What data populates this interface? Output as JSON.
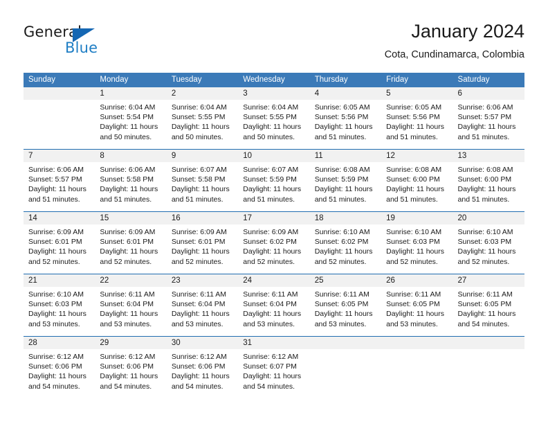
{
  "brand": {
    "name_top": "General",
    "name_bottom": "Blue",
    "triangle_color": "#1567b3",
    "blue_color": "#1f7ec4"
  },
  "header": {
    "title": "January 2024",
    "subtitle": "Cota, Cundinamarca, Colombia"
  },
  "theme": {
    "header_blue": "#3b7ab8",
    "row_rule_blue": "#1f6cb0",
    "daynum_band": "#f1f1f1",
    "text": "#1a1a1a"
  },
  "calendar": {
    "weekday_headers": [
      "Sunday",
      "Monday",
      "Tuesday",
      "Wednesday",
      "Thursday",
      "Friday",
      "Saturday"
    ],
    "weeks": [
      [
        {
          "day": "",
          "sunrise": "",
          "sunset": "",
          "daylight": "",
          "empty": true
        },
        {
          "day": "1",
          "sunrise": "Sunrise: 6:04 AM",
          "sunset": "Sunset: 5:54 PM",
          "daylight": "Daylight: 11 hours and 50 minutes."
        },
        {
          "day": "2",
          "sunrise": "Sunrise: 6:04 AM",
          "sunset": "Sunset: 5:55 PM",
          "daylight": "Daylight: 11 hours and 50 minutes."
        },
        {
          "day": "3",
          "sunrise": "Sunrise: 6:04 AM",
          "sunset": "Sunset: 5:55 PM",
          "daylight": "Daylight: 11 hours and 50 minutes."
        },
        {
          "day": "4",
          "sunrise": "Sunrise: 6:05 AM",
          "sunset": "Sunset: 5:56 PM",
          "daylight": "Daylight: 11 hours and 51 minutes."
        },
        {
          "day": "5",
          "sunrise": "Sunrise: 6:05 AM",
          "sunset": "Sunset: 5:56 PM",
          "daylight": "Daylight: 11 hours and 51 minutes."
        },
        {
          "day": "6",
          "sunrise": "Sunrise: 6:06 AM",
          "sunset": "Sunset: 5:57 PM",
          "daylight": "Daylight: 11 hours and 51 minutes."
        }
      ],
      [
        {
          "day": "7",
          "sunrise": "Sunrise: 6:06 AM",
          "sunset": "Sunset: 5:57 PM",
          "daylight": "Daylight: 11 hours and 51 minutes."
        },
        {
          "day": "8",
          "sunrise": "Sunrise: 6:06 AM",
          "sunset": "Sunset: 5:58 PM",
          "daylight": "Daylight: 11 hours and 51 minutes."
        },
        {
          "day": "9",
          "sunrise": "Sunrise: 6:07 AM",
          "sunset": "Sunset: 5:58 PM",
          "daylight": "Daylight: 11 hours and 51 minutes."
        },
        {
          "day": "10",
          "sunrise": "Sunrise: 6:07 AM",
          "sunset": "Sunset: 5:59 PM",
          "daylight": "Daylight: 11 hours and 51 minutes."
        },
        {
          "day": "11",
          "sunrise": "Sunrise: 6:08 AM",
          "sunset": "Sunset: 5:59 PM",
          "daylight": "Daylight: 11 hours and 51 minutes."
        },
        {
          "day": "12",
          "sunrise": "Sunrise: 6:08 AM",
          "sunset": "Sunset: 6:00 PM",
          "daylight": "Daylight: 11 hours and 51 minutes."
        },
        {
          "day": "13",
          "sunrise": "Sunrise: 6:08 AM",
          "sunset": "Sunset: 6:00 PM",
          "daylight": "Daylight: 11 hours and 51 minutes."
        }
      ],
      [
        {
          "day": "14",
          "sunrise": "Sunrise: 6:09 AM",
          "sunset": "Sunset: 6:01 PM",
          "daylight": "Daylight: 11 hours and 52 minutes."
        },
        {
          "day": "15",
          "sunrise": "Sunrise: 6:09 AM",
          "sunset": "Sunset: 6:01 PM",
          "daylight": "Daylight: 11 hours and 52 minutes."
        },
        {
          "day": "16",
          "sunrise": "Sunrise: 6:09 AM",
          "sunset": "Sunset: 6:01 PM",
          "daylight": "Daylight: 11 hours and 52 minutes."
        },
        {
          "day": "17",
          "sunrise": "Sunrise: 6:09 AM",
          "sunset": "Sunset: 6:02 PM",
          "daylight": "Daylight: 11 hours and 52 minutes."
        },
        {
          "day": "18",
          "sunrise": "Sunrise: 6:10 AM",
          "sunset": "Sunset: 6:02 PM",
          "daylight": "Daylight: 11 hours and 52 minutes."
        },
        {
          "day": "19",
          "sunrise": "Sunrise: 6:10 AM",
          "sunset": "Sunset: 6:03 PM",
          "daylight": "Daylight: 11 hours and 52 minutes."
        },
        {
          "day": "20",
          "sunrise": "Sunrise: 6:10 AM",
          "sunset": "Sunset: 6:03 PM",
          "daylight": "Daylight: 11 hours and 52 minutes."
        }
      ],
      [
        {
          "day": "21",
          "sunrise": "Sunrise: 6:10 AM",
          "sunset": "Sunset: 6:03 PM",
          "daylight": "Daylight: 11 hours and 53 minutes."
        },
        {
          "day": "22",
          "sunrise": "Sunrise: 6:11 AM",
          "sunset": "Sunset: 6:04 PM",
          "daylight": "Daylight: 11 hours and 53 minutes."
        },
        {
          "day": "23",
          "sunrise": "Sunrise: 6:11 AM",
          "sunset": "Sunset: 6:04 PM",
          "daylight": "Daylight: 11 hours and 53 minutes."
        },
        {
          "day": "24",
          "sunrise": "Sunrise: 6:11 AM",
          "sunset": "Sunset: 6:04 PM",
          "daylight": "Daylight: 11 hours and 53 minutes."
        },
        {
          "day": "25",
          "sunrise": "Sunrise: 6:11 AM",
          "sunset": "Sunset: 6:05 PM",
          "daylight": "Daylight: 11 hours and 53 minutes."
        },
        {
          "day": "26",
          "sunrise": "Sunrise: 6:11 AM",
          "sunset": "Sunset: 6:05 PM",
          "daylight": "Daylight: 11 hours and 53 minutes."
        },
        {
          "day": "27",
          "sunrise": "Sunrise: 6:11 AM",
          "sunset": "Sunset: 6:05 PM",
          "daylight": "Daylight: 11 hours and 54 minutes."
        }
      ],
      [
        {
          "day": "28",
          "sunrise": "Sunrise: 6:12 AM",
          "sunset": "Sunset: 6:06 PM",
          "daylight": "Daylight: 11 hours and 54 minutes."
        },
        {
          "day": "29",
          "sunrise": "Sunrise: 6:12 AM",
          "sunset": "Sunset: 6:06 PM",
          "daylight": "Daylight: 11 hours and 54 minutes."
        },
        {
          "day": "30",
          "sunrise": "Sunrise: 6:12 AM",
          "sunset": "Sunset: 6:06 PM",
          "daylight": "Daylight: 11 hours and 54 minutes."
        },
        {
          "day": "31",
          "sunrise": "Sunrise: 6:12 AM",
          "sunset": "Sunset: 6:07 PM",
          "daylight": "Daylight: 11 hours and 54 minutes."
        },
        {
          "day": "",
          "sunrise": "",
          "sunset": "",
          "daylight": "",
          "empty": true
        },
        {
          "day": "",
          "sunrise": "",
          "sunset": "",
          "daylight": "",
          "empty": true
        },
        {
          "day": "",
          "sunrise": "",
          "sunset": "",
          "daylight": "",
          "empty": true
        }
      ]
    ]
  }
}
